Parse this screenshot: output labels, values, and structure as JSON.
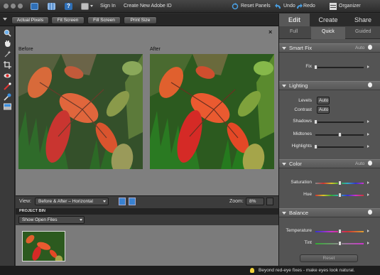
{
  "menubar": {
    "sign_in": "Sign In",
    "create_id": "Create New Adobe ID",
    "reset_panels": "Reset Panels",
    "undo": "Undo",
    "redo": "Redo",
    "organizer": "Organizer"
  },
  "options_bar": {
    "actual_pixels": "Actual Pixels",
    "fit_screen": "Fit Screen",
    "fill_screen": "Fill Screen",
    "print_size": "Print Size"
  },
  "canvas": {
    "before_label": "Before",
    "after_label": "After",
    "close_glyph": "×"
  },
  "view_bar": {
    "view_label": "View:",
    "view_value": "Before & After – Horizontal",
    "zoom_label": "Zoom:",
    "zoom_value": "8%"
  },
  "project_bin": {
    "title": "PROJECT BIN",
    "filter_value": "Show Open Files"
  },
  "panel": {
    "tabs": [
      "Edit",
      "Create",
      "Share"
    ],
    "subtabs": [
      "Full",
      "Quick",
      "Guided"
    ],
    "active_subtab": "Quick",
    "sections": {
      "smart_fix": {
        "title": "Smart Fix",
        "auto": "Auto",
        "fix_label": "Fix",
        "fix_level": 0.0
      },
      "lighting": {
        "title": "Lighting",
        "levels_label": "Levels",
        "levels_button": "Auto",
        "contrast_label": "Contrast",
        "contrast_button": "Auto",
        "shadows_label": "Shadows",
        "shadows_level": 0.0,
        "midtones_label": "Midtones",
        "midtones_level": 0.5,
        "highlights_label": "Highlights",
        "highlights_level": 0.0
      },
      "color": {
        "title": "Color",
        "auto": "Auto",
        "saturation_label": "Saturation",
        "saturation_level": 0.5,
        "hue_label": "Hue",
        "hue_level": 0.5
      },
      "balance": {
        "title": "Balance",
        "temperature_label": "Temperature",
        "temperature_level": 0.5,
        "tint_label": "Tint",
        "tint_level": 0.5
      }
    },
    "reset_button": "Reset"
  },
  "status": {
    "tip": "Beyond red-eye fixes - make eyes look natural."
  },
  "colors": {
    "accent_blue": "#4a9ee0",
    "panel_bg": "#545454",
    "canvas_bg": "#7f7f7f"
  },
  "icons": [
    "photo-icon",
    "grid-icon",
    "help-icon",
    "layout-icon",
    "reset-panels-icon",
    "undo-icon",
    "redo-icon",
    "organizer-icon",
    "zoom-tool-icon",
    "hand-tool-icon",
    "magic-wand-icon",
    "crop-icon",
    "red-eye-icon",
    "whiten-teeth-icon",
    "blue-skies-icon",
    "bw-icon"
  ]
}
